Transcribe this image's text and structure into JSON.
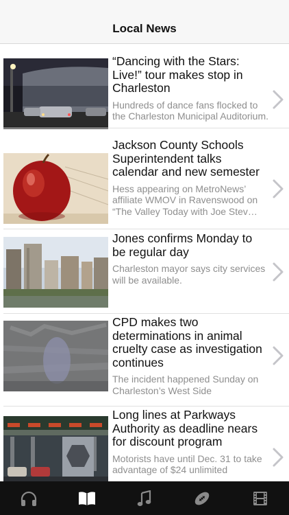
{
  "header": {
    "title": "Local News"
  },
  "articles": [
    {
      "headline": "“Dancing with the Stars: Live!” tour makes stop in Charleston",
      "summary": "Hundreds of dance fans flocked to the Charleston Municipal Auditorium."
    },
    {
      "headline": "Jackson County Schools Superintendent talks calendar and new semester",
      "summary": "Hess appearing on MetroNews’ affiliate WMOV in Ravenswood on “The Valley Today with Joe Stev…"
    },
    {
      "headline": "Jones confirms Monday to be regular day",
      "summary": "Charleston mayor says city services will be available."
    },
    {
      "headline": "CPD makes two determinations in animal cruelty case as investigation continues",
      "summary": "The incident happened Sunday on Charleston’s West Side"
    },
    {
      "headline": "Long lines at Parkways Authority as deadline nears for discount program",
      "summary": "Motorists have until Dec. 31 to take advantage of $24 unlimited"
    }
  ],
  "tabbar": {
    "tabs": [
      {
        "icon": "headphones-icon",
        "selected": false
      },
      {
        "icon": "book-icon",
        "selected": true
      },
      {
        "icon": "music-note-icon",
        "selected": false
      },
      {
        "icon": "football-icon",
        "selected": false
      },
      {
        "icon": "film-icon",
        "selected": false
      }
    ]
  }
}
